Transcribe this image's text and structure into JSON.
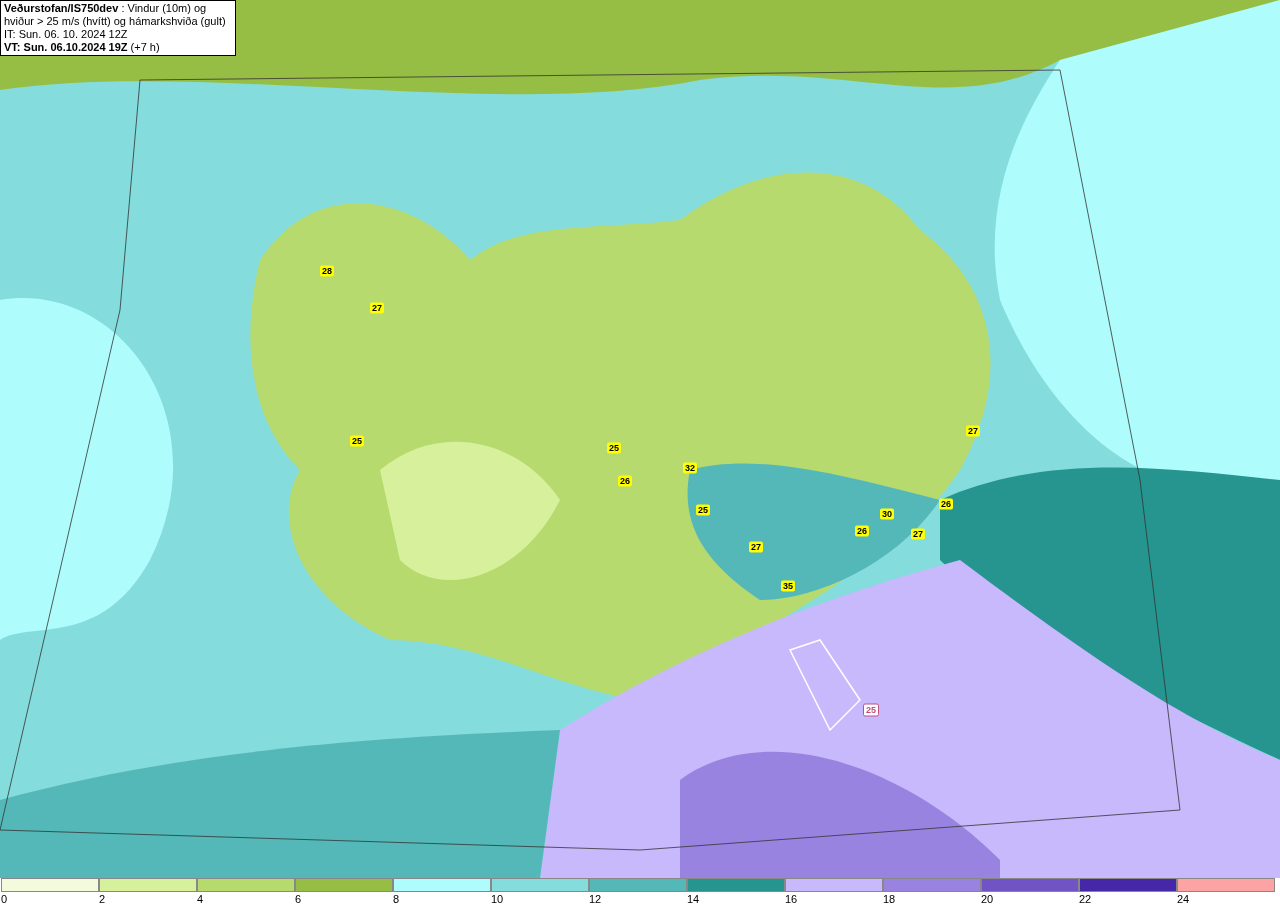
{
  "header": {
    "description": "**Veðurstofan/IS750dev** : Vindur (10m) og hviður > 25 m/s (hvítt) og hámarkshviða (gult)",
    "issue_time": "IT: Sun. 06. 10. 2024 12Z",
    "valid_time": "**VT: Sun. 06.10.2024 19Z** (+7 h)"
  },
  "map": {
    "gust_labels": [
      {
        "value": "28",
        "kind": "max"
      },
      {
        "value": "27",
        "kind": "max"
      },
      {
        "value": "25",
        "kind": "max"
      },
      {
        "value": "25",
        "kind": "max"
      },
      {
        "value": "26",
        "kind": "max"
      },
      {
        "value": "32",
        "kind": "max"
      },
      {
        "value": "25",
        "kind": "max"
      },
      {
        "value": "27",
        "kind": "max"
      },
      {
        "value": "35",
        "kind": "max"
      },
      {
        "value": "26",
        "kind": "max"
      },
      {
        "value": "30",
        "kind": "max"
      },
      {
        "value": "27",
        "kind": "max"
      },
      {
        "value": "26",
        "kind": "max"
      },
      {
        "value": "27",
        "kind": "max"
      },
      {
        "value": "25",
        "kind": "gust"
      }
    ]
  },
  "legend": [
    {
      "label": "0",
      "color": "#f4fbdc"
    },
    {
      "label": "2",
      "color": "#d6f09c"
    },
    {
      "label": "4",
      "color": "#b7da6e"
    },
    {
      "label": "6",
      "color": "#97be44"
    },
    {
      "label": "8",
      "color": "#aefcfc"
    },
    {
      "label": "10",
      "color": "#84dcdc"
    },
    {
      "label": "12",
      "color": "#55b8b8"
    },
    {
      "label": "14",
      "color": "#26948f"
    },
    {
      "label": "16",
      "color": "#c8b8fc"
    },
    {
      "label": "18",
      "color": "#9884e0"
    },
    {
      "label": "20",
      "color": "#7054c4"
    },
    {
      "label": "22",
      "color": "#4428a8"
    },
    {
      "label": "24",
      "color": "#fca4a4"
    }
  ]
}
